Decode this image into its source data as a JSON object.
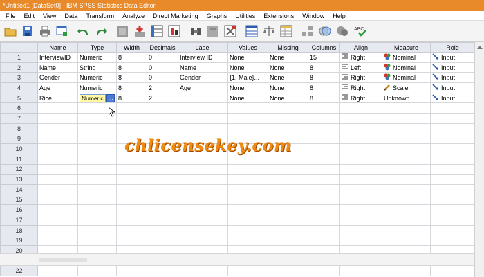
{
  "window": {
    "title": "*Untitled1 [DataSet0] - IBM SPSS Statistics Data Editor"
  },
  "menu": [
    {
      "label": "File",
      "u": "F",
      "rest": "ile"
    },
    {
      "label": "Edit",
      "u": "E",
      "rest": "dit"
    },
    {
      "label": "View",
      "u": "V",
      "rest": "iew"
    },
    {
      "label": "Data",
      "u": "D",
      "rest": "ata"
    },
    {
      "label": "Transform",
      "u": "T",
      "rest": "ransform"
    },
    {
      "label": "Analyze",
      "u": "A",
      "rest": "nalyze"
    },
    {
      "label": "Direct Marketing",
      "u": "M",
      "pre": "Direct ",
      "rest": "arketing"
    },
    {
      "label": "Graphs",
      "u": "G",
      "rest": "raphs"
    },
    {
      "label": "Utilities",
      "u": "U",
      "rest": "tilities"
    },
    {
      "label": "Extensions",
      "u": "x",
      "pre": "E",
      "rest": "tensions"
    },
    {
      "label": "Window",
      "u": "W",
      "rest": "indow"
    },
    {
      "label": "Help",
      "u": "H",
      "rest": "elp"
    }
  ],
  "toolbar": {
    "icons": [
      "open-folder-icon",
      "save-icon",
      "print-icon",
      "recall-dialog-icon",
      "undo-icon",
      "redo-icon",
      "goto-case-icon",
      "goto-variable-icon",
      "variables-icon",
      "run-descriptives-icon",
      "find-icon",
      "insert-cases-icon",
      "insert-variable-icon",
      "split-file-icon",
      "weight-cases-icon",
      "select-cases-icon",
      "value-labels-icon",
      "use-sets-icon",
      "show-all-variables-icon",
      "spell-check-icon"
    ],
    "spell_label": "ABC"
  },
  "grid": {
    "columns": [
      "Name",
      "Type",
      "Width",
      "Decimals",
      "Label",
      "Values",
      "Missing",
      "Columns",
      "Align",
      "Measure",
      "Role"
    ],
    "rows": [
      {
        "n": "1",
        "name": "InterviewID",
        "type": "Numeric",
        "width": "8",
        "decimals": "0",
        "label": "Interview ID",
        "values": "None",
        "missing": "None",
        "columns": "15",
        "align": "Right",
        "measure": "Nominal",
        "role": "Input"
      },
      {
        "n": "2",
        "name": "Name",
        "type": "String",
        "width": "8",
        "decimals": "0",
        "label": "Name",
        "values": "None",
        "missing": "None",
        "columns": "8",
        "align": "Left",
        "measure": "Nominal",
        "role": "Input"
      },
      {
        "n": "3",
        "name": "Gender",
        "type": "Numeric",
        "width": "8",
        "decimals": "0",
        "label": "Gender",
        "values": "{1, Male}...",
        "missing": "None",
        "columns": "8",
        "align": "Right",
        "measure": "Nominal",
        "role": "Input"
      },
      {
        "n": "4",
        "name": "Age",
        "type": "Numeric",
        "width": "8",
        "decimals": "2",
        "label": "Age",
        "values": "None",
        "missing": "None",
        "columns": "8",
        "align": "Right",
        "measure": "Scale",
        "role": "Input"
      },
      {
        "n": "5",
        "name": "Rice",
        "type": "Numeric",
        "width": "8",
        "decimals": "2",
        "label": "",
        "values": "None",
        "missing": "None",
        "columns": "8",
        "align": "Right",
        "measure": "Unknown",
        "role": "Input"
      }
    ],
    "empty_rows": [
      "6",
      "7",
      "8",
      "9",
      "10",
      "11",
      "12",
      "13",
      "14",
      "15",
      "16",
      "17",
      "18",
      "19",
      "20"
    ],
    "bottom_row": "22"
  },
  "type_cell_button": "...",
  "watermark": "chlicensekey.com",
  "colors": {
    "title_bar": "#e98a2a",
    "header_bg": "#e6e9ef",
    "editing_cell": "#fff9a8",
    "watermark": "#f08a12"
  }
}
